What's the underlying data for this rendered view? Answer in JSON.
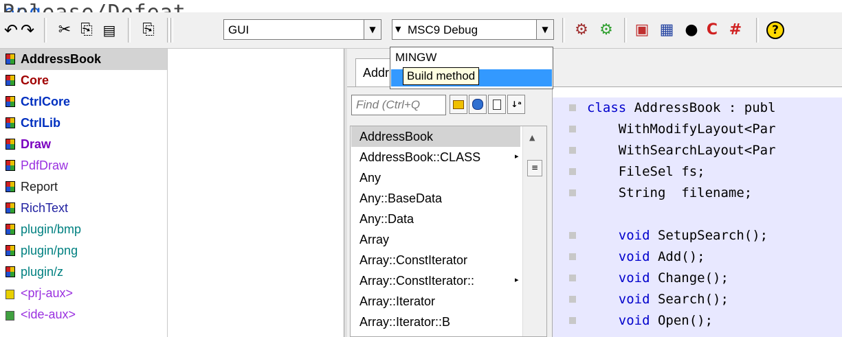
{
  "title_fragment": {
    "prefix": "r, ",
    "link": "bmp, png",
    "suffix": ", new Release/Defeat Fix"
  },
  "toolbar": {
    "icons": [
      {
        "name": "undo-icon",
        "glyph": "↶"
      },
      {
        "name": "redo-icon",
        "glyph": "↷"
      },
      {
        "name": "cut-icon",
        "glyph": "✂"
      },
      {
        "name": "copy-icon",
        "glyph": "⎘"
      },
      {
        "name": "paste-icon",
        "glyph": "📋"
      },
      {
        "name": "duplicate-icon",
        "glyph": "⎘"
      }
    ],
    "main_config": "GUI",
    "build_method": "MSC9 Debug",
    "right_icons": [
      {
        "name": "build-icon",
        "glyph": "⚙"
      },
      {
        "name": "rebuild-icon",
        "glyph": "⚙"
      },
      {
        "name": "windows-icon",
        "glyph": "▣"
      },
      {
        "name": "calendar-icon",
        "glyph": "▦"
      },
      {
        "name": "debug-icon",
        "glyph": "●"
      },
      {
        "name": "stop-icon",
        "glyph": "C"
      },
      {
        "name": "hash-icon",
        "glyph": "#"
      },
      {
        "name": "help-icon",
        "glyph": "?"
      }
    ]
  },
  "build_dropdown": {
    "options": [
      "MINGW",
      "MSC9 Debug"
    ],
    "tooltip": "Build method"
  },
  "packages": [
    {
      "label": "AddressBook",
      "color": "#000000",
      "bold": true,
      "selected": true,
      "icon": "package-icon"
    },
    {
      "label": "Core",
      "color": "#a00000",
      "bold": true,
      "icon": "package-icon"
    },
    {
      "label": "CtrlCore",
      "color": "#0030c0",
      "bold": true,
      "icon": "package-icon"
    },
    {
      "label": "CtrlLib",
      "color": "#0030c0",
      "bold": true,
      "icon": "package-icon"
    },
    {
      "label": "Draw",
      "color": "#7a00c0",
      "bold": true,
      "icon": "package-icon"
    },
    {
      "label": "PdfDraw",
      "color": "#9a30e0",
      "bold": false,
      "icon": "package-icon"
    },
    {
      "label": "Report",
      "color": "#202020",
      "bold": false,
      "icon": "package-icon"
    },
    {
      "label": "RichText",
      "color": "#2020a0",
      "bold": false,
      "icon": "package-icon"
    },
    {
      "label": "plugin/bmp",
      "color": "#008080",
      "bold": false,
      "icon": "package-icon"
    },
    {
      "label": "plugin/png",
      "color": "#008080",
      "bold": false,
      "icon": "package-icon"
    },
    {
      "label": "plugin/z",
      "color": "#008080",
      "bold": false,
      "icon": "package-icon"
    },
    {
      "label": "<prj-aux>",
      "color": "#9a30e0",
      "bold": false,
      "icon": "aux-icon"
    },
    {
      "label": "<ide-aux>",
      "color": "#9a30e0",
      "bold": false,
      "icon": "aux-icon"
    }
  ],
  "tab": {
    "label": "Addr"
  },
  "find": {
    "placeholder": "Find (Ctrl+Q"
  },
  "nav_items": [
    {
      "label": "AddressBook",
      "selected": true,
      "arrow": false
    },
    {
      "label": "AddressBook::CLASS",
      "arrow": true
    },
    {
      "label": "Any",
      "arrow": false
    },
    {
      "label": "Any::BaseData",
      "arrow": false
    },
    {
      "label": "Any::Data",
      "arrow": false
    },
    {
      "label": "Array",
      "arrow": false
    },
    {
      "label": "Array::ConstIterator",
      "arrow": false
    },
    {
      "label": "Array::ConstIterator::",
      "arrow": true
    },
    {
      "label": "Array::Iterator",
      "arrow": false
    },
    {
      "label": "Array::Iterator::B",
      "arrow": false
    }
  ],
  "code_lines": [
    {
      "kw": "class",
      "rest": " AddressBook : publ"
    },
    {
      "kw": "",
      "rest": "    WithModifyLayout<Par"
    },
    {
      "kw": "",
      "rest": "    WithSearchLayout<Par"
    },
    {
      "kw": "",
      "rest": "    FileSel fs;"
    },
    {
      "kw": "",
      "rest": "    String  filename;"
    },
    {
      "kw": "",
      "rest": "",
      "nomark": true
    },
    {
      "kw": "    void",
      "rest": " SetupSearch();"
    },
    {
      "kw": "    void",
      "rest": " Add();"
    },
    {
      "kw": "    void",
      "rest": " Change();"
    },
    {
      "kw": "    void",
      "rest": " Search();"
    },
    {
      "kw": "    void",
      "rest": " Open();"
    }
  ]
}
